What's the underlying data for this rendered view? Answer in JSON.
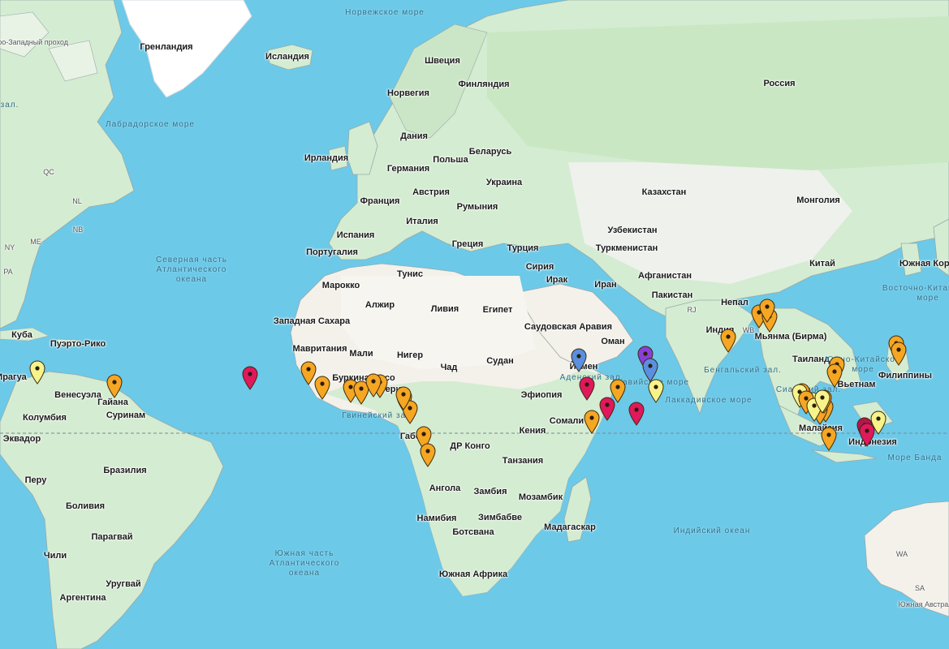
{
  "map": {
    "colors": {
      "ocean": "#6cc9e8",
      "land_green": "#cfe9c9",
      "land_light": "#eef1ec",
      "land_desert": "#f4f1e8",
      "border": "#8a8a8a",
      "ice": "#ffffff"
    },
    "equator_visible": true,
    "labels": [
      {
        "text": "Норвежское море",
        "kind": "water"
      },
      {
        "text": "Северо-Западный проход",
        "kind": "minor"
      },
      {
        "text": "Гренландия",
        "kind": "country"
      },
      {
        "text": "Исландия",
        "kind": "country"
      },
      {
        "text": "Швеция",
        "kind": "country"
      },
      {
        "text": "Финляндия",
        "kind": "country"
      },
      {
        "text": "Норвегия",
        "kind": "country"
      },
      {
        "text": "Россия",
        "kind": "country"
      },
      {
        "text": "Лабрадорское море",
        "kind": "water"
      },
      {
        "text": "Дания",
        "kind": "country"
      },
      {
        "text": "Ирландия",
        "kind": "country"
      },
      {
        "text": "Беларусь",
        "kind": "country"
      },
      {
        "text": "Германия",
        "kind": "country"
      },
      {
        "text": "Польша",
        "kind": "country"
      },
      {
        "text": "Украина",
        "kind": "country"
      },
      {
        "text": "Франция",
        "kind": "country"
      },
      {
        "text": "Австрия",
        "kind": "country"
      },
      {
        "text": "Казахстан",
        "kind": "country"
      },
      {
        "text": "Монголия",
        "kind": "country"
      },
      {
        "text": "Румыния",
        "kind": "country"
      },
      {
        "text": "Италия",
        "kind": "country"
      },
      {
        "text": "Узбекистан",
        "kind": "country"
      },
      {
        "text": "Испания",
        "kind": "country"
      },
      {
        "text": "Греция",
        "kind": "country"
      },
      {
        "text": "Турция",
        "kind": "country"
      },
      {
        "text": "Туркменистан",
        "kind": "country"
      },
      {
        "text": "Португалия",
        "kind": "country"
      },
      {
        "text": "Северная часть Атлантического океана",
        "kind": "water"
      },
      {
        "text": "Китай",
        "kind": "country"
      },
      {
        "text": "Тунис",
        "kind": "country"
      },
      {
        "text": "Сирия",
        "kind": "country"
      },
      {
        "text": "Ирак",
        "kind": "country"
      },
      {
        "text": "Афганистан",
        "kind": "country"
      },
      {
        "text": "Марокко",
        "kind": "country"
      },
      {
        "text": "Иран",
        "kind": "country"
      },
      {
        "text": "Южная Корея",
        "kind": "country"
      },
      {
        "text": "Алжир",
        "kind": "country"
      },
      {
        "text": "Ливия",
        "kind": "country"
      },
      {
        "text": "Египет",
        "kind": "country"
      },
      {
        "text": "Пакистан",
        "kind": "country"
      },
      {
        "text": "Восточно-Китайское море",
        "kind": "water"
      },
      {
        "text": "Западная Сахара",
        "kind": "country"
      },
      {
        "text": "Саудовская Аравия",
        "kind": "country"
      },
      {
        "text": "Непал",
        "kind": "country"
      },
      {
        "text": "Индия",
        "kind": "country"
      },
      {
        "text": "Мьянма (Бирма)",
        "kind": "country"
      },
      {
        "text": "Куба",
        "kind": "country"
      },
      {
        "text": "Пуэрто-Рико",
        "kind": "country"
      },
      {
        "text": "Мавритания",
        "kind": "country"
      },
      {
        "text": "Оман",
        "kind": "country"
      },
      {
        "text": "Мали",
        "kind": "country"
      },
      {
        "text": "Нигер",
        "kind": "country"
      },
      {
        "text": "Чад",
        "kind": "country"
      },
      {
        "text": "Судан",
        "kind": "country"
      },
      {
        "text": "Таиланд",
        "kind": "country"
      },
      {
        "text": "Южно-Китайское море",
        "kind": "water"
      },
      {
        "text": "Аравийское море",
        "kind": "water"
      },
      {
        "text": "Бенгальский зал.",
        "kind": "water"
      },
      {
        "text": "Йемен",
        "kind": "country"
      },
      {
        "text": "Аденский зал.",
        "kind": "water"
      },
      {
        "text": "Филиппины",
        "kind": "country"
      },
      {
        "text": "Вьетнам",
        "kind": "country"
      },
      {
        "text": "Венесуэла",
        "kind": "country"
      },
      {
        "text": "Буркина-Фасо",
        "kind": "country"
      },
      {
        "text": "Гайана",
        "kind": "country"
      },
      {
        "text": "Нигерия",
        "kind": "country"
      },
      {
        "text": "Эфиопия",
        "kind": "country"
      },
      {
        "text": "Сиамский зал.",
        "kind": "water"
      },
      {
        "text": "Лаккадивское море",
        "kind": "water"
      },
      {
        "text": "Суринам",
        "kind": "country"
      },
      {
        "text": "Колумбия",
        "kind": "country"
      },
      {
        "text": "Гвинейский зал.",
        "kind": "water"
      },
      {
        "text": "Сомали",
        "kind": "country"
      },
      {
        "text": "Малайзия",
        "kind": "country"
      },
      {
        "text": "Эквадор",
        "kind": "country"
      },
      {
        "text": "Кения",
        "kind": "country"
      },
      {
        "text": "Габон",
        "kind": "country"
      },
      {
        "text": "ДР Конго",
        "kind": "country"
      },
      {
        "text": "Индонезия",
        "kind": "country"
      },
      {
        "text": "Море Банда",
        "kind": "water"
      },
      {
        "text": "Перу",
        "kind": "country"
      },
      {
        "text": "Бразилия",
        "kind": "country"
      },
      {
        "text": "Танзания",
        "kind": "country"
      },
      {
        "text": "Ангола",
        "kind": "country"
      },
      {
        "text": "Замбия",
        "kind": "country"
      },
      {
        "text": "Мозамбик",
        "kind": "country"
      },
      {
        "text": "Боливия",
        "kind": "country"
      },
      {
        "text": "Зимбабве",
        "kind": "country"
      },
      {
        "text": "Намибия",
        "kind": "country"
      },
      {
        "text": "Мадагаскар",
        "kind": "country"
      },
      {
        "text": "Индийский океан",
        "kind": "water"
      },
      {
        "text": "Парагвай",
        "kind": "country"
      },
      {
        "text": "Ботсвана",
        "kind": "country"
      },
      {
        "text": "Южная часть Атлантического океана",
        "kind": "water"
      },
      {
        "text": "Чили",
        "kind": "country"
      },
      {
        "text": "Уругвай",
        "kind": "country"
      },
      {
        "text": "Южная Африка",
        "kind": "country"
      },
      {
        "text": "Аргентина",
        "kind": "country"
      },
      {
        "text": "WA",
        "kind": "minor"
      },
      {
        "text": "SA",
        "kind": "minor"
      },
      {
        "text": "Южная Австралия",
        "kind": "minor"
      },
      {
        "text": "QC",
        "kind": "minor"
      },
      {
        "text": "NL",
        "kind": "minor"
      },
      {
        "text": "NB",
        "kind": "minor"
      },
      {
        "text": "ME",
        "kind": "minor"
      },
      {
        "text": "NY",
        "kind": "minor"
      },
      {
        "text": "PA",
        "kind": "minor"
      },
      {
        "text": "RJ",
        "kind": "minor"
      },
      {
        "text": "WB",
        "kind": "minor"
      },
      {
        "text": "Ирагуа",
        "kind": "country"
      },
      {
        "text": "зал.",
        "kind": "water"
      }
    ],
    "pins": [
      {
        "color": "#f7f38b",
        "icon": "map-pin"
      },
      {
        "color": "#f5a623",
        "icon": "map-pin"
      },
      {
        "color": "#e0185c",
        "icon": "map-pin"
      },
      {
        "color": "#f5a623",
        "icon": "map-pin"
      },
      {
        "color": "#f5a623",
        "icon": "map-pin"
      },
      {
        "color": "#f5a623",
        "icon": "map-pin"
      },
      {
        "color": "#f5a623",
        "icon": "map-pin"
      },
      {
        "color": "#f5a623",
        "icon": "map-pin"
      },
      {
        "color": "#f5a623",
        "icon": "map-pin"
      },
      {
        "color": "#f5a623",
        "icon": "map-pin"
      },
      {
        "color": "#f5a623",
        "icon": "map-pin"
      },
      {
        "color": "#f5a623",
        "icon": "map-pin"
      },
      {
        "color": "#f5a623",
        "icon": "map-pin"
      },
      {
        "color": "#f5a623",
        "icon": "map-pin"
      },
      {
        "color": "#5b8fe0",
        "icon": "map-pin"
      },
      {
        "color": "#e0185c",
        "icon": "map-pin"
      },
      {
        "color": "#8a3fd6",
        "icon": "map-pin"
      },
      {
        "color": "#5b8fe0",
        "icon": "map-pin"
      },
      {
        "color": "#f7f38b",
        "icon": "map-pin"
      },
      {
        "color": "#f5a623",
        "icon": "map-pin"
      },
      {
        "color": "#e0185c",
        "icon": "map-pin"
      },
      {
        "color": "#e0185c",
        "icon": "map-pin"
      },
      {
        "color": "#f5a623",
        "icon": "map-pin"
      },
      {
        "color": "#f5a623",
        "icon": "map-pin"
      },
      {
        "color": "#f5a623",
        "icon": "map-pin"
      },
      {
        "color": "#f5a623",
        "icon": "map-pin"
      },
      {
        "color": "#f5a623",
        "icon": "map-pin"
      },
      {
        "color": "#f5a623",
        "icon": "map-pin"
      },
      {
        "color": "#f5a623",
        "icon": "map-pin"
      },
      {
        "color": "#f5a623",
        "icon": "map-pin"
      },
      {
        "color": "#f5a623",
        "icon": "map-pin"
      },
      {
        "color": "#f5a623",
        "icon": "map-pin"
      },
      {
        "color": "#f7f38b",
        "icon": "map-pin"
      },
      {
        "color": "#f7f38b",
        "icon": "map-pin"
      },
      {
        "color": "#f5a623",
        "icon": "map-pin"
      },
      {
        "color": "#f7f38b",
        "icon": "map-pin"
      },
      {
        "color": "#f5a623",
        "icon": "map-pin"
      },
      {
        "color": "#f5a623",
        "icon": "map-pin"
      },
      {
        "color": "#f7f38b",
        "icon": "map-pin"
      },
      {
        "color": "#f5a623",
        "icon": "map-pin"
      },
      {
        "color": "#f7f38b",
        "icon": "map-pin"
      },
      {
        "color": "#f5a623",
        "icon": "map-pin"
      },
      {
        "color": "#b5154e",
        "icon": "map-pin"
      },
      {
        "color": "#e0185c",
        "icon": "map-pin"
      },
      {
        "color": "#f7f38b",
        "icon": "map-pin"
      }
    ]
  }
}
